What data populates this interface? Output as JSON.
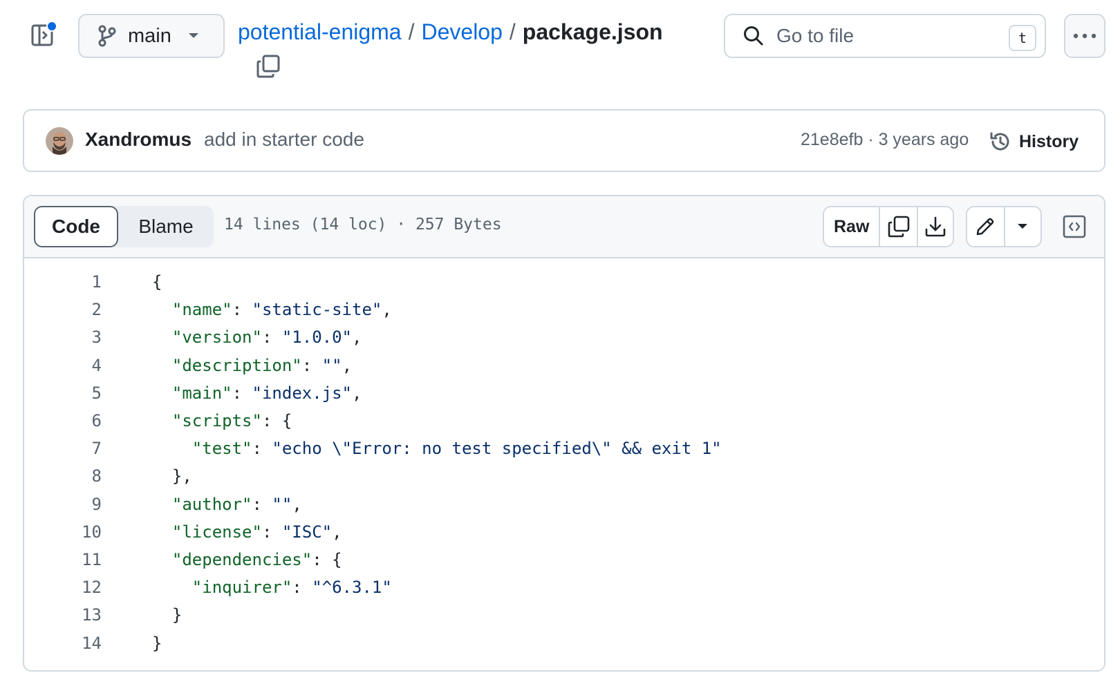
{
  "header": {
    "branch": "main",
    "breadcrumb": {
      "repo": "potential-enigma",
      "sep": "/",
      "folder": "Develop",
      "file": "package.json"
    },
    "search_placeholder": "Go to file",
    "search_shortcut": "t"
  },
  "commit": {
    "author": "Xandromus",
    "message": "add in starter code",
    "hash_time": "21e8efb · 3 years ago",
    "history_label": "History"
  },
  "file": {
    "tabs": [
      "Code",
      "Blame"
    ],
    "active_tab": "Code",
    "info": "14 lines (14 loc) · 257 Bytes",
    "raw_label": "Raw"
  },
  "code_lines": [
    {
      "n": "1",
      "parts": [
        [
          "p",
          "{"
        ]
      ]
    },
    {
      "n": "2",
      "parts": [
        [
          "p",
          "  "
        ],
        [
          "key",
          "\"name\""
        ],
        [
          "p",
          ": "
        ],
        [
          "k",
          "\"static-site\""
        ],
        [
          "p",
          ","
        ]
      ]
    },
    {
      "n": "3",
      "parts": [
        [
          "p",
          "  "
        ],
        [
          "key",
          "\"version\""
        ],
        [
          "p",
          ": "
        ],
        [
          "k",
          "\"1.0.0\""
        ],
        [
          "p",
          ","
        ]
      ]
    },
    {
      "n": "4",
      "parts": [
        [
          "p",
          "  "
        ],
        [
          "key",
          "\"description\""
        ],
        [
          "p",
          ": "
        ],
        [
          "k",
          "\"\""
        ],
        [
          "p",
          ","
        ]
      ]
    },
    {
      "n": "5",
      "parts": [
        [
          "p",
          "  "
        ],
        [
          "key",
          "\"main\""
        ],
        [
          "p",
          ": "
        ],
        [
          "k",
          "\"index.js\""
        ],
        [
          "p",
          ","
        ]
      ]
    },
    {
      "n": "6",
      "parts": [
        [
          "p",
          "  "
        ],
        [
          "key",
          "\"scripts\""
        ],
        [
          "p",
          ": {"
        ]
      ]
    },
    {
      "n": "7",
      "parts": [
        [
          "p",
          "    "
        ],
        [
          "key",
          "\"test\""
        ],
        [
          "p",
          ": "
        ],
        [
          "k",
          "\"echo \\\"Error: no test specified\\\" && exit 1\""
        ]
      ]
    },
    {
      "n": "8",
      "parts": [
        [
          "p",
          "  },"
        ]
      ]
    },
    {
      "n": "9",
      "parts": [
        [
          "p",
          "  "
        ],
        [
          "key",
          "\"author\""
        ],
        [
          "p",
          ": "
        ],
        [
          "k",
          "\"\""
        ],
        [
          "p",
          ","
        ]
      ]
    },
    {
      "n": "10",
      "parts": [
        [
          "p",
          "  "
        ],
        [
          "key",
          "\"license\""
        ],
        [
          "p",
          ": "
        ],
        [
          "k",
          "\"ISC\""
        ],
        [
          "p",
          ","
        ]
      ]
    },
    {
      "n": "11",
      "parts": [
        [
          "p",
          "  "
        ],
        [
          "key",
          "\"dependencies\""
        ],
        [
          "p",
          ": {"
        ]
      ]
    },
    {
      "n": "12",
      "parts": [
        [
          "p",
          "    "
        ],
        [
          "key",
          "\"inquirer\""
        ],
        [
          "p",
          ": "
        ],
        [
          "k",
          "\"^6.3.1\""
        ]
      ]
    },
    {
      "n": "13",
      "parts": [
        [
          "p",
          "  }"
        ]
      ]
    },
    {
      "n": "14",
      "parts": [
        [
          "p",
          "}"
        ]
      ]
    }
  ],
  "colors": {
    "link": "#0969da",
    "string": "#0a3069",
    "json_key": "#116329",
    "border": "#d1d9e0",
    "notification_dot": "#0969da"
  }
}
